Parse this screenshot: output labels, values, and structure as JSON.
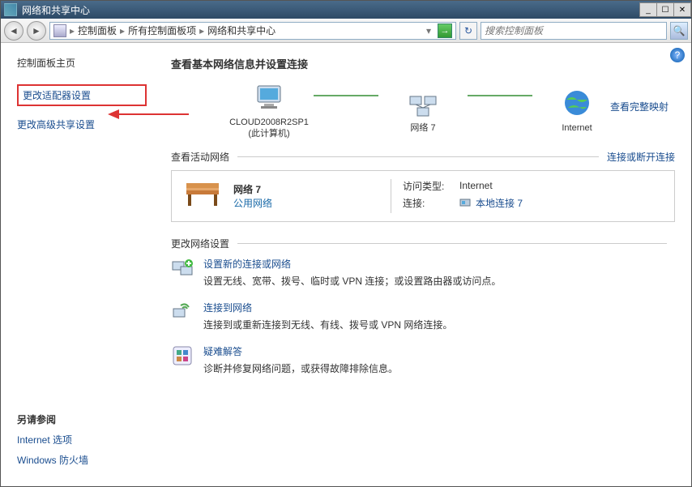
{
  "titlebar": {
    "title": "网络和共享中心"
  },
  "toolbar": {
    "breadcrumb": {
      "root": "控制面板",
      "mid": "所有控制面板项",
      "leaf": "网络和共享中心"
    },
    "search_placeholder": "搜索控制面板"
  },
  "sidebar": {
    "home": "控制面板主页",
    "link_adapter": "更改适配器设置",
    "link_advanced": "更改高级共享设置",
    "see_also_h": "另请参阅",
    "see_also_1": "Internet 选项",
    "see_also_2": "Windows 防火墙"
  },
  "main": {
    "heading": "查看基本网络信息并设置连接",
    "view_full_map": "查看完整映射",
    "map": {
      "this_pc_name": "CLOUD2008R2SP1",
      "this_pc_sub": "(此计算机)",
      "net_label": "网络  7",
      "internet_label": "Internet"
    },
    "active_h": "查看活动网络",
    "active_link": "连接或断开连接",
    "netbox": {
      "name": "网络  7",
      "type": "公用网络",
      "access_k": "访问类型:",
      "access_v": "Internet",
      "conn_k": "连接:",
      "conn_v": "本地连接 7"
    },
    "settings_h": "更改网络设置",
    "items": [
      {
        "title": "设置新的连接或网络",
        "desc": "设置无线、宽带、拨号、临时或 VPN 连接；或设置路由器或访问点。"
      },
      {
        "title": "连接到网络",
        "desc": "连接到或重新连接到无线、有线、拨号或 VPN 网络连接。"
      },
      {
        "title": "疑难解答",
        "desc": "诊断并修复网络问题，或获得故障排除信息。"
      }
    ]
  }
}
